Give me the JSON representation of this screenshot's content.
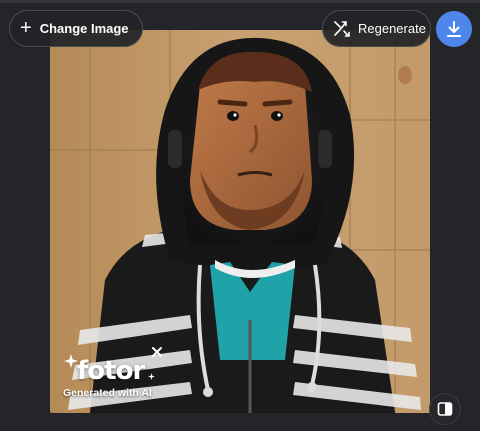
{
  "toolbar": {
    "change_image_icon": "plus-icon",
    "change_image_label": "Change Image",
    "regenerate_icon": "regenerate-arrows-icon",
    "regenerate_label": "Regenerate",
    "download_icon": "download-icon"
  },
  "image": {
    "alt": "Generated image",
    "watermark": {
      "brand": "fotor",
      "caption": "Generated with AI",
      "close_icon": "close-icon"
    }
  },
  "controls": {
    "compare_icon": "compare-split-icon"
  },
  "colors": {
    "background": "#242529",
    "accent": "#4f86ea",
    "button_bg": "#222327"
  }
}
